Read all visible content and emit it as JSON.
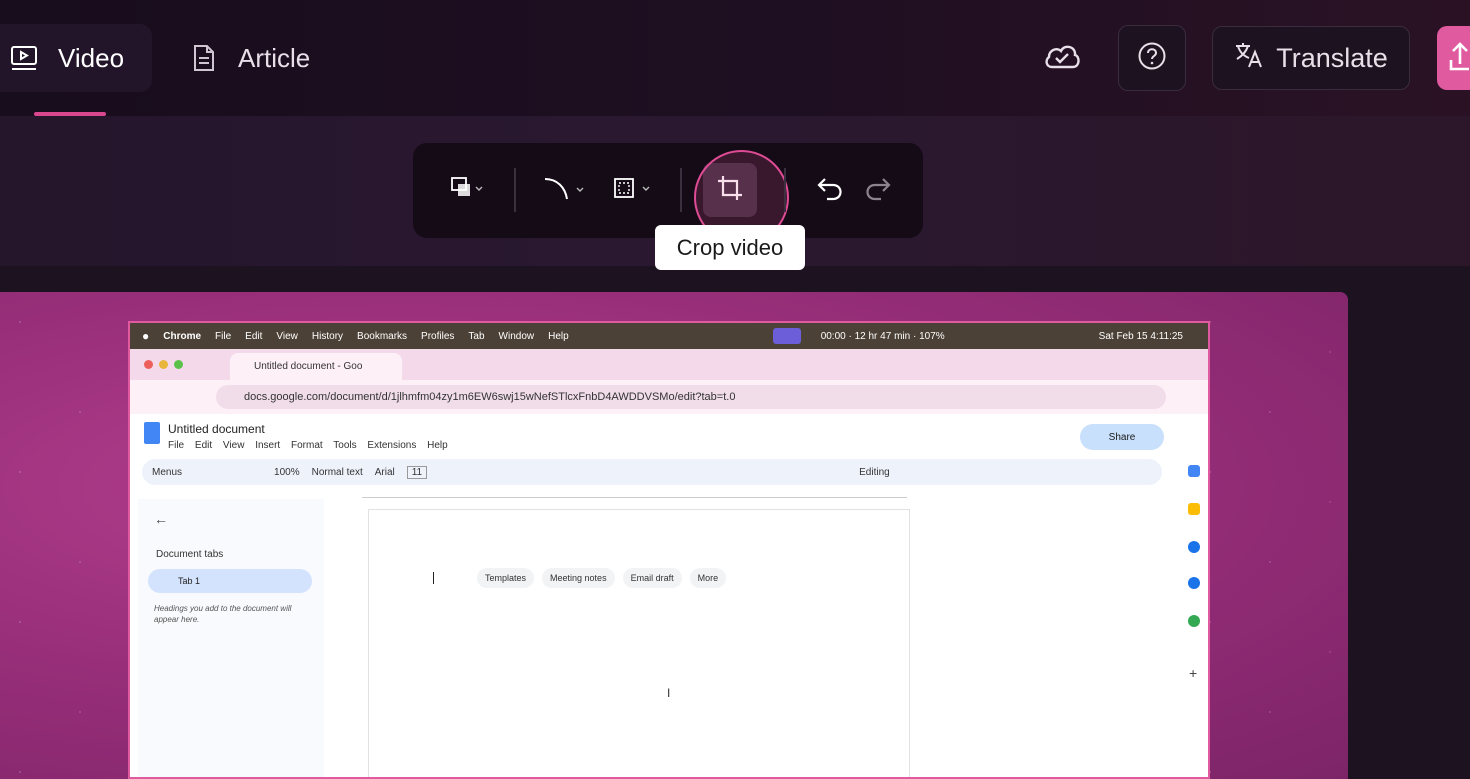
{
  "topbar": {
    "tabs": [
      {
        "label": "Video",
        "icon": "video-icon",
        "active": true
      },
      {
        "label": "Article",
        "icon": "document-icon",
        "active": false
      }
    ],
    "translate_label": "Translate",
    "accent": "#d9488f"
  },
  "toolbar": {
    "tooltip": "Crop video"
  },
  "recording": {
    "mac_menu": [
      "Chrome",
      "File",
      "Edit",
      "View",
      "History",
      "Bookmarks",
      "Profiles",
      "Tab",
      "Window",
      "Help"
    ],
    "mac_status": "00:00 · 12 hr 47 min · 107%",
    "mac_datetime": "Sat Feb 15  4:11:25",
    "chrome_tab_title": "Untitled document - Goo",
    "url": "docs.google.com/document/d/1jlhmfm04zy1m6EW6swj15wNefSTlcxFnbD4AWDDVSMo/edit?tab=t.0",
    "doc_title": "Untitled document",
    "doc_menu": [
      "File",
      "Edit",
      "View",
      "Insert",
      "Format",
      "Tools",
      "Extensions",
      "Help"
    ],
    "share_label": "Share",
    "toolbar_items": [
      "Menus",
      "100%",
      "Normal text",
      "Arial",
      "11",
      "Editing"
    ],
    "side_title": "Document tabs",
    "tab_label": "Tab 1",
    "side_hint": "Headings you add to the document will appear here.",
    "chips": [
      "Templates",
      "Meeting notes",
      "Email draft",
      "More"
    ]
  }
}
